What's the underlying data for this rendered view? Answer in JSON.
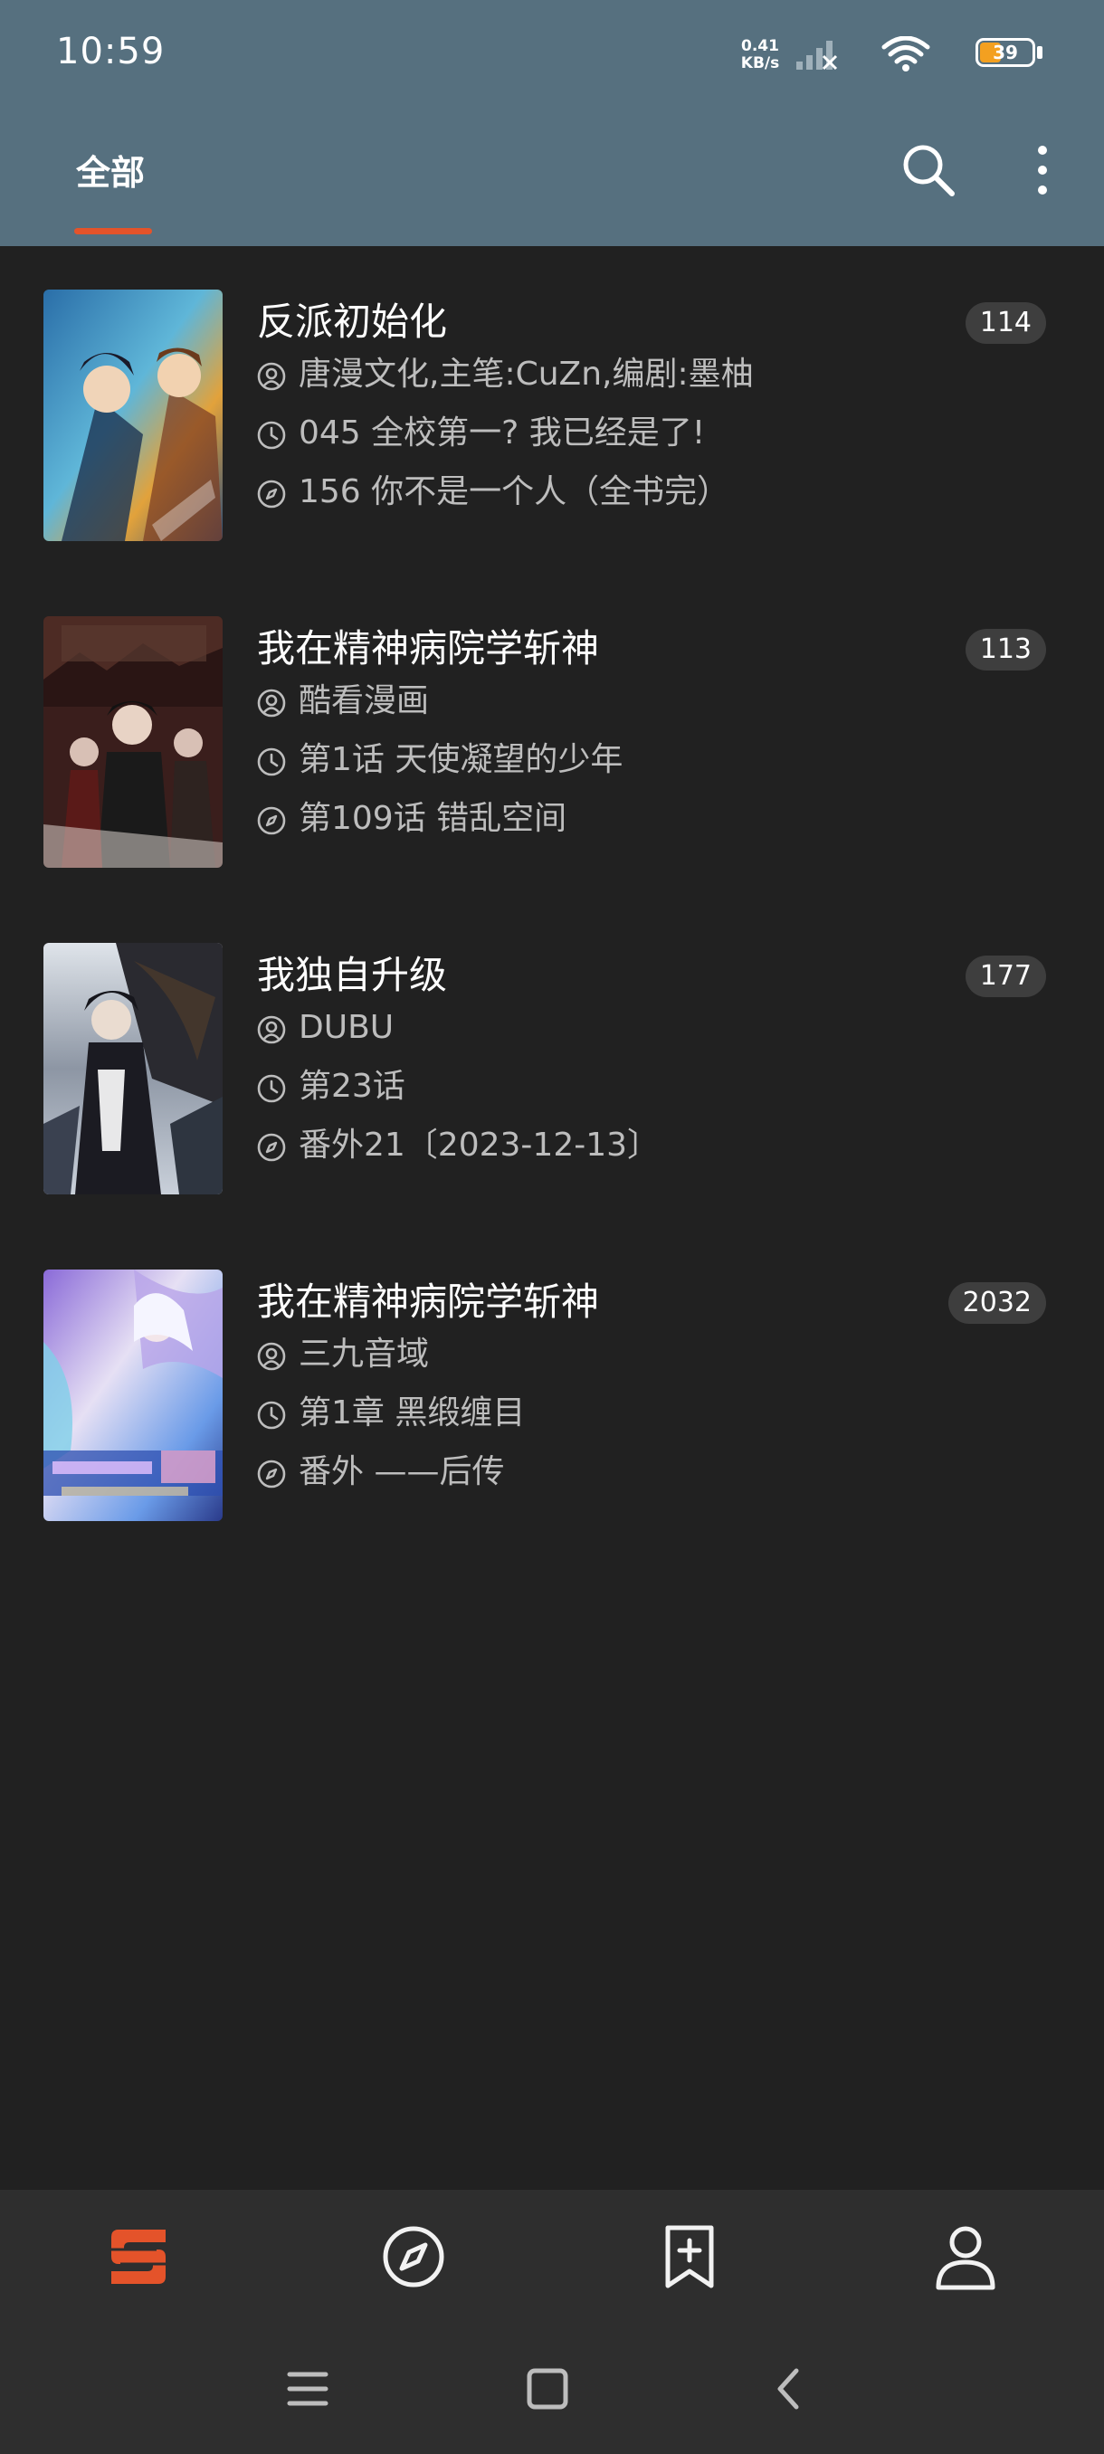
{
  "status_bar": {
    "time": "10:59",
    "net_speed_value": "0.41",
    "net_speed_unit": "KB/s",
    "battery": "39"
  },
  "header": {
    "tab_label": "全部",
    "accent_color": "#e4532a",
    "background_color": "#56707f"
  },
  "comics": [
    {
      "title": "反派初始化",
      "count": "114",
      "author": "唐漫文化,主笔:CuZn,编剧:墨柚",
      "last_read": "045 全校第一? 我已经是了!",
      "latest": "156 你不是一个人（全书完）"
    },
    {
      "title": "我在精神病院学斩神",
      "count": "113",
      "author": "酷看漫画",
      "last_read": "第1话 天使凝望的少年",
      "latest": "第109话 错乱空间"
    },
    {
      "title": "我独自升级",
      "count": "177",
      "author": "DUBU",
      "last_read": "第23话",
      "latest": "番外21〔2023-12-13〕"
    },
    {
      "title": "我在精神病院学斩神",
      "count": "2032",
      "author": "三九音域",
      "last_read": "第1章 黑缎缠目",
      "latest": "番外 ——后传"
    }
  ],
  "bottom_nav": [
    "bookshelf-icon",
    "discover-icon",
    "bookmark-add-icon",
    "profile-icon"
  ]
}
